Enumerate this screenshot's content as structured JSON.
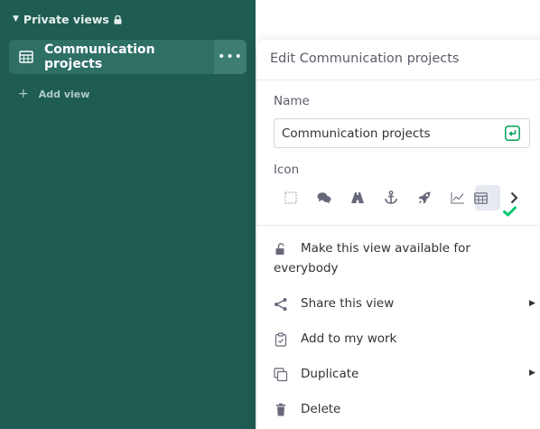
{
  "sidebar": {
    "section_title": "Private views",
    "section_icon": "lock-icon",
    "active_view": {
      "label": "Communication projects",
      "icon": "table-view-icon",
      "more_label": "•••"
    },
    "add_view_label": "Add view",
    "background_color": "#1f5c52"
  },
  "popup": {
    "title": "Edit Communication projects",
    "name_label": "Name",
    "name_value": "Communication projects",
    "icon_label": "Icon",
    "icons": [
      "empty-square-icon",
      "chat-icon",
      "road-icon",
      "anchor-icon",
      "rocket-icon",
      "line-chart-icon",
      "table-view-icon"
    ],
    "selected_icon": "table-view-icon",
    "accent_color": "#00ca72",
    "menu": {
      "make_available_line1": "Make this view available for",
      "make_available_line2": "everybody",
      "share": "Share this view",
      "add_to_work": "Add to my work",
      "duplicate": "Duplicate",
      "delete": "Delete"
    }
  }
}
